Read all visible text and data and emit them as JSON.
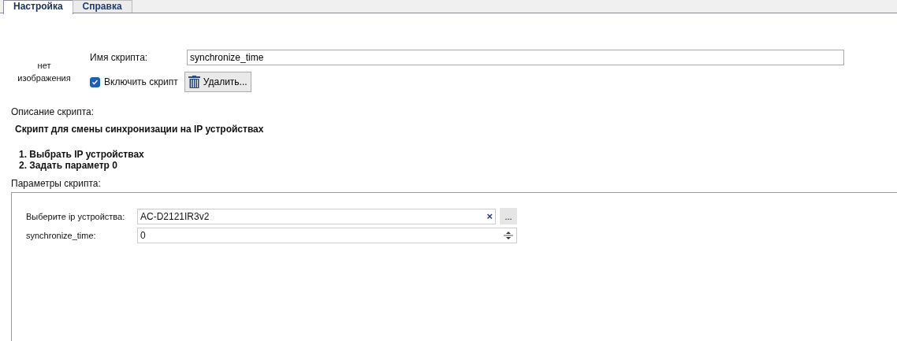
{
  "tabs": [
    {
      "label": "Настройка",
      "selected": true
    },
    {
      "label": "Справка",
      "selected": false
    }
  ],
  "image_placeholder": "нет изображения",
  "script_name": {
    "label": "Имя скрипта:",
    "value": "synchronize_time"
  },
  "enable": {
    "label": "Включить скрипт",
    "checked": true
  },
  "delete_button": "Удалить...",
  "description": {
    "label": "Описание скрипта:",
    "title": "Скрипт для смены синхронизации на IP устройствах",
    "steps": [
      "1. Выбрать IP устройствах",
      "2. Задать параметр 0"
    ]
  },
  "parameters": {
    "label": "Параметры скрипта:",
    "rows": [
      {
        "kind": "picker",
        "label": "Выберите ip устройства:",
        "value": "AC-D2121IR3v2",
        "clear": "×",
        "browse": "..."
      },
      {
        "kind": "spinner",
        "label": "synchronize_time:",
        "value": "0"
      }
    ]
  }
}
